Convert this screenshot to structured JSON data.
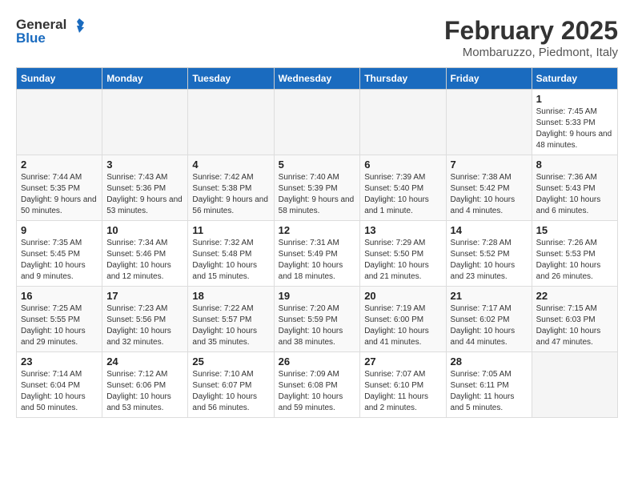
{
  "header": {
    "logo_line1": "General",
    "logo_line2": "Blue",
    "title": "February 2025",
    "subtitle": "Mombaruzzo, Piedmont, Italy"
  },
  "weekdays": [
    "Sunday",
    "Monday",
    "Tuesday",
    "Wednesday",
    "Thursday",
    "Friday",
    "Saturday"
  ],
  "weeks": [
    [
      {
        "day": "",
        "detail": ""
      },
      {
        "day": "",
        "detail": ""
      },
      {
        "day": "",
        "detail": ""
      },
      {
        "day": "",
        "detail": ""
      },
      {
        "day": "",
        "detail": ""
      },
      {
        "day": "",
        "detail": ""
      },
      {
        "day": "1",
        "detail": "Sunrise: 7:45 AM\nSunset: 5:33 PM\nDaylight: 9 hours and 48 minutes."
      }
    ],
    [
      {
        "day": "2",
        "detail": "Sunrise: 7:44 AM\nSunset: 5:35 PM\nDaylight: 9 hours and 50 minutes."
      },
      {
        "day": "3",
        "detail": "Sunrise: 7:43 AM\nSunset: 5:36 PM\nDaylight: 9 hours and 53 minutes."
      },
      {
        "day": "4",
        "detail": "Sunrise: 7:42 AM\nSunset: 5:38 PM\nDaylight: 9 hours and 56 minutes."
      },
      {
        "day": "5",
        "detail": "Sunrise: 7:40 AM\nSunset: 5:39 PM\nDaylight: 9 hours and 58 minutes."
      },
      {
        "day": "6",
        "detail": "Sunrise: 7:39 AM\nSunset: 5:40 PM\nDaylight: 10 hours and 1 minute."
      },
      {
        "day": "7",
        "detail": "Sunrise: 7:38 AM\nSunset: 5:42 PM\nDaylight: 10 hours and 4 minutes."
      },
      {
        "day": "8",
        "detail": "Sunrise: 7:36 AM\nSunset: 5:43 PM\nDaylight: 10 hours and 6 minutes."
      }
    ],
    [
      {
        "day": "9",
        "detail": "Sunrise: 7:35 AM\nSunset: 5:45 PM\nDaylight: 10 hours and 9 minutes."
      },
      {
        "day": "10",
        "detail": "Sunrise: 7:34 AM\nSunset: 5:46 PM\nDaylight: 10 hours and 12 minutes."
      },
      {
        "day": "11",
        "detail": "Sunrise: 7:32 AM\nSunset: 5:48 PM\nDaylight: 10 hours and 15 minutes."
      },
      {
        "day": "12",
        "detail": "Sunrise: 7:31 AM\nSunset: 5:49 PM\nDaylight: 10 hours and 18 minutes."
      },
      {
        "day": "13",
        "detail": "Sunrise: 7:29 AM\nSunset: 5:50 PM\nDaylight: 10 hours and 21 minutes."
      },
      {
        "day": "14",
        "detail": "Sunrise: 7:28 AM\nSunset: 5:52 PM\nDaylight: 10 hours and 23 minutes."
      },
      {
        "day": "15",
        "detail": "Sunrise: 7:26 AM\nSunset: 5:53 PM\nDaylight: 10 hours and 26 minutes."
      }
    ],
    [
      {
        "day": "16",
        "detail": "Sunrise: 7:25 AM\nSunset: 5:55 PM\nDaylight: 10 hours and 29 minutes."
      },
      {
        "day": "17",
        "detail": "Sunrise: 7:23 AM\nSunset: 5:56 PM\nDaylight: 10 hours and 32 minutes."
      },
      {
        "day": "18",
        "detail": "Sunrise: 7:22 AM\nSunset: 5:57 PM\nDaylight: 10 hours and 35 minutes."
      },
      {
        "day": "19",
        "detail": "Sunrise: 7:20 AM\nSunset: 5:59 PM\nDaylight: 10 hours and 38 minutes."
      },
      {
        "day": "20",
        "detail": "Sunrise: 7:19 AM\nSunset: 6:00 PM\nDaylight: 10 hours and 41 minutes."
      },
      {
        "day": "21",
        "detail": "Sunrise: 7:17 AM\nSunset: 6:02 PM\nDaylight: 10 hours and 44 minutes."
      },
      {
        "day": "22",
        "detail": "Sunrise: 7:15 AM\nSunset: 6:03 PM\nDaylight: 10 hours and 47 minutes."
      }
    ],
    [
      {
        "day": "23",
        "detail": "Sunrise: 7:14 AM\nSunset: 6:04 PM\nDaylight: 10 hours and 50 minutes."
      },
      {
        "day": "24",
        "detail": "Sunrise: 7:12 AM\nSunset: 6:06 PM\nDaylight: 10 hours and 53 minutes."
      },
      {
        "day": "25",
        "detail": "Sunrise: 7:10 AM\nSunset: 6:07 PM\nDaylight: 10 hours and 56 minutes."
      },
      {
        "day": "26",
        "detail": "Sunrise: 7:09 AM\nSunset: 6:08 PM\nDaylight: 10 hours and 59 minutes."
      },
      {
        "day": "27",
        "detail": "Sunrise: 7:07 AM\nSunset: 6:10 PM\nDaylight: 11 hours and 2 minutes."
      },
      {
        "day": "28",
        "detail": "Sunrise: 7:05 AM\nSunset: 6:11 PM\nDaylight: 11 hours and 5 minutes."
      },
      {
        "day": "",
        "detail": ""
      }
    ]
  ]
}
